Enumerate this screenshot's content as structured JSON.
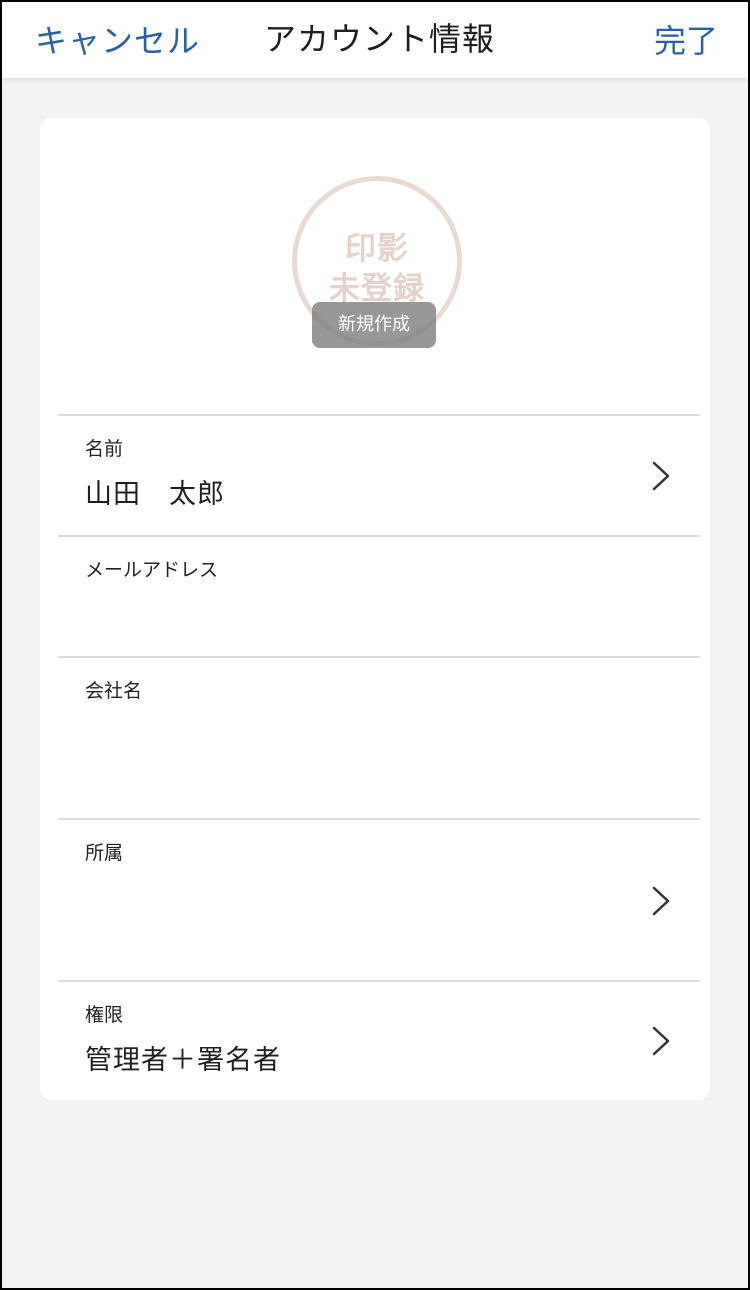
{
  "navbar": {
    "cancel_label": "キャンセル",
    "title": "アカウント情報",
    "done_label": "完了"
  },
  "stamp": {
    "line1": "印影",
    "line2": "未登録",
    "create_label": "新規作成"
  },
  "fields": {
    "name": {
      "label": "名前",
      "value": "山田　太郎"
    },
    "email": {
      "label": "メールアドレス",
      "value": ""
    },
    "company": {
      "label": "会社名",
      "value": ""
    },
    "department": {
      "label": "所属",
      "value": ""
    },
    "permission": {
      "label": "権限",
      "value": "管理者＋署名者"
    }
  },
  "colors": {
    "accent": "#2a61a6",
    "stamp": "#e5d3cb",
    "background": "#f3f3f3"
  },
  "icons": {
    "row_chevron": "chevron-right-icon"
  }
}
